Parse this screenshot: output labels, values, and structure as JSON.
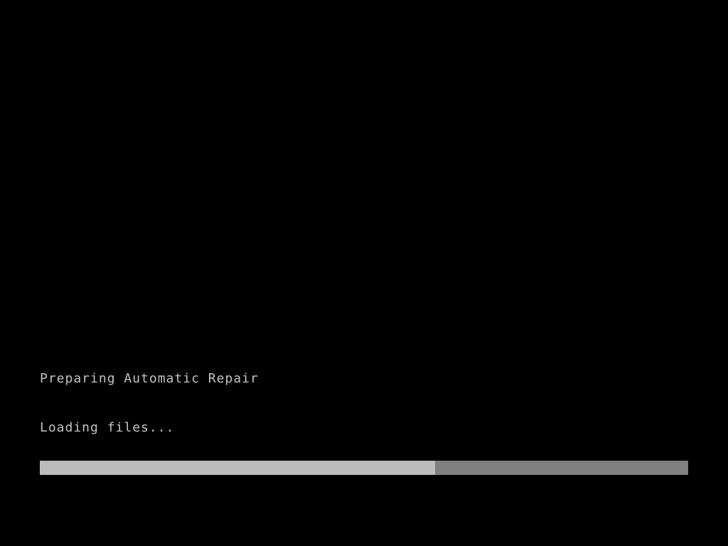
{
  "boot": {
    "title": "Preparing Automatic Repair",
    "loading_label": "Loading files...",
    "progress_percent": 61
  }
}
